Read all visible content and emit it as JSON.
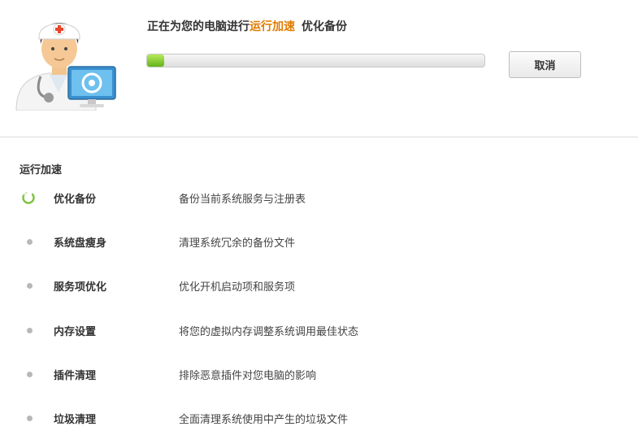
{
  "header": {
    "status_prefix": "正在为您的电脑进行",
    "status_highlight": "运行加速",
    "status_current": "优化备份",
    "progress": 0.05,
    "cancel_label": "取消",
    "accent_color": "#e07b00",
    "progress_color": "#63b21b"
  },
  "section": {
    "title": "运行加速"
  },
  "tasks": [
    {
      "name": "优化备份",
      "desc": "备份当前系统服务与注册表",
      "state": "in-progress"
    },
    {
      "name": "系统盘瘦身",
      "desc": "清理系统冗余的备份文件",
      "state": "pending"
    },
    {
      "name": "服务项优化",
      "desc": "优化开机启动项和服务项",
      "state": "pending"
    },
    {
      "name": "内存设置",
      "desc": "将您的虚拟内存调整系统调用最佳状态",
      "state": "pending"
    },
    {
      "name": "插件清理",
      "desc": "排除恶意插件对您电脑的影响",
      "state": "pending"
    },
    {
      "name": "垃圾清理",
      "desc": "全面清理系统使用中产生的垃圾文件",
      "state": "pending"
    }
  ],
  "icons": {
    "illustration": "doctor-with-monitor-icon",
    "in_progress": "spinner-icon",
    "pending": "bullet-icon"
  }
}
